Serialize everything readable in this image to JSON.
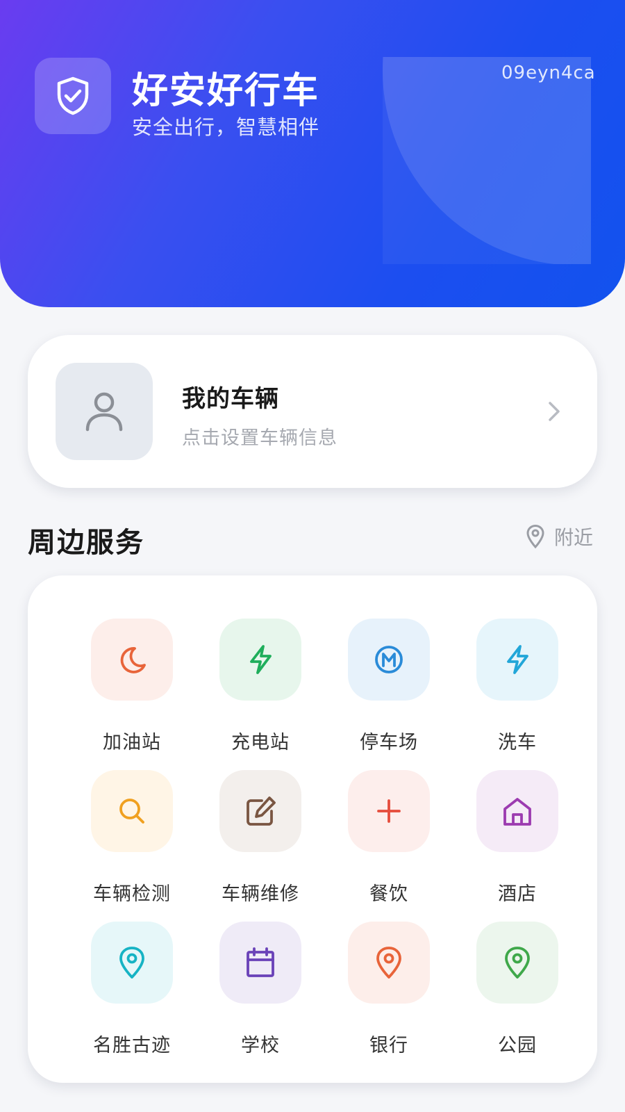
{
  "header": {
    "title": "好安好行车",
    "subtitle": "安全出行，智慧相伴",
    "code": "09eyn4ca",
    "logo_icon": "shield-check-icon"
  },
  "vehicle": {
    "title": "我的车辆",
    "subtitle": "点击设置车辆信息",
    "avatar_icon": "user-icon",
    "arrow_icon": "chevron-right-icon"
  },
  "services_section": {
    "title": "周边服务",
    "nearby_label": "附近",
    "nearby_icon": "location-pin-icon"
  },
  "services": [
    {
      "label": "加油站",
      "icon": "moon-icon",
      "color": "#e8643a",
      "bg": "#fdeeea"
    },
    {
      "label": "充电站",
      "icon": "lightning-icon",
      "color": "#1fae5b",
      "bg": "#e7f6ec"
    },
    {
      "label": "停车场",
      "icon": "metro-m-icon",
      "color": "#2a8bd8",
      "bg": "#e7f2fb"
    },
    {
      "label": "洗车",
      "icon": "lightning-icon",
      "color": "#22a6d8",
      "bg": "#e6f5fb"
    },
    {
      "label": "车辆检测",
      "icon": "search-icon",
      "color": "#f0a020",
      "bg": "#fff5e6"
    },
    {
      "label": "车辆维修",
      "icon": "edit-icon",
      "color": "#7a5642",
      "bg": "#f3efec"
    },
    {
      "label": "餐饮",
      "icon": "plus-icon",
      "color": "#e54c3c",
      "bg": "#fdeeec"
    },
    {
      "label": "酒店",
      "icon": "home-icon",
      "color": "#9c3bb0",
      "bg": "#f5ebf7"
    },
    {
      "label": "名胜古迹",
      "icon": "location-pin-icon",
      "color": "#16b3c4",
      "bg": "#e6f7f9"
    },
    {
      "label": "学校",
      "icon": "calendar-icon",
      "color": "#6a42b8",
      "bg": "#efebf7"
    },
    {
      "label": "银行",
      "icon": "location-pin-icon",
      "color": "#e8643a",
      "bg": "#fdeeea"
    },
    {
      "label": "公园",
      "icon": "location-pin-icon",
      "color": "#3fa84a",
      "bg": "#ecf6ed"
    }
  ]
}
